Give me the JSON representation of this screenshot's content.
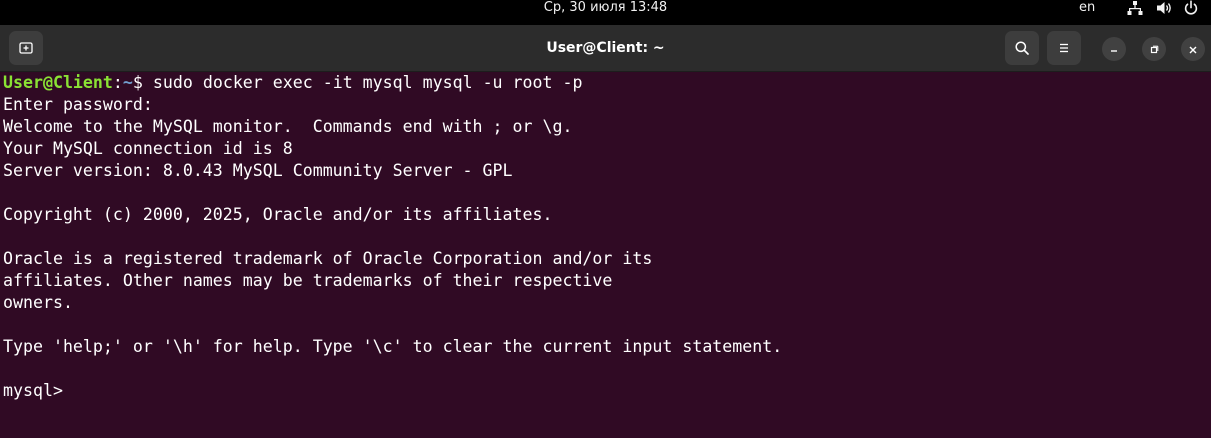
{
  "topbar": {
    "clock": "Ср, 30 июля  13:48",
    "language": "en",
    "tray_icons": [
      "network-icon",
      "volume-icon",
      "power-icon"
    ]
  },
  "window": {
    "title": "User@Client: ~",
    "buttons": [
      "new-tab-icon",
      "search-icon",
      "menu-icon",
      "minimize-icon",
      "maximize-icon",
      "close-icon"
    ]
  },
  "terminal": {
    "prompt_user": "User@Client",
    "prompt_sep": ":",
    "prompt_path": "~",
    "prompt_symbol": "$ ",
    "command": "sudo docker exec -it mysql mysql -u root -p",
    "output": [
      "Enter password:",
      "Welcome to the MySQL monitor.  Commands end with ; or \\g.",
      "Your MySQL connection id is 8",
      "Server version: 8.0.43 MySQL Community Server - GPL",
      "",
      "Copyright (c) 2000, 2025, Oracle and/or its affiliates.",
      "",
      "Oracle is a registered trademark of Oracle Corporation and/or its",
      "affiliates. Other names may be trademarks of their respective",
      "owners.",
      "",
      "Type 'help;' or '\\h' for help. Type '\\c' to clear the current input statement.",
      "",
      "mysql>"
    ]
  },
  "colors": {
    "terminal_bg": "#300a24",
    "prompt_user": "#8ae234",
    "prompt_path": "#729fcf",
    "headerbar_bg": "#2c2c2c",
    "topbar_bg": "#000000"
  }
}
